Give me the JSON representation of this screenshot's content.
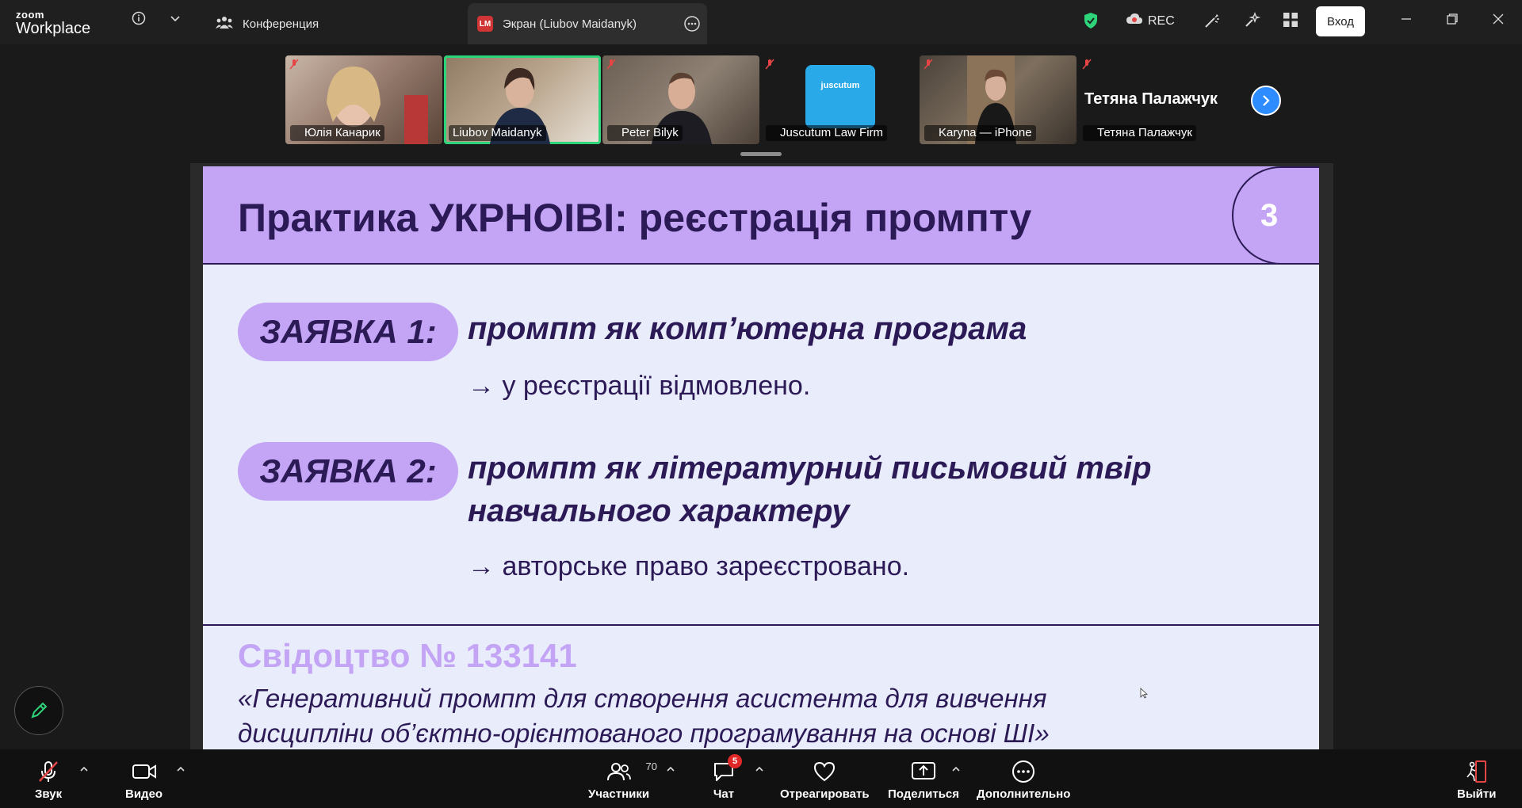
{
  "app": {
    "logo_top": "zoom",
    "logo_bottom": "Workplace",
    "colors": {
      "accent": "#2d8cff",
      "active_speaker": "#2ed47a",
      "rec": "#e64545",
      "slide_purple": "#c3a4f5",
      "slide_text": "#2b1a55"
    }
  },
  "titlebar": {
    "tab_conference": "Конференция",
    "tab_screen": "Экран (Liubov Maidanyk)",
    "tab_screen_avatar": "LM",
    "rec_label": "REC",
    "login_label": "Вход"
  },
  "gallery": {
    "participants": [
      {
        "name": "Юлія Канарик",
        "muted": true
      },
      {
        "name": "Liubov Maidanyk",
        "muted": false,
        "active": true
      },
      {
        "name": "Peter Bilyk",
        "muted": true
      },
      {
        "name": "Juscutum Law Firm",
        "muted": true
      },
      {
        "name": "Karyna — iPhone",
        "muted": true
      },
      {
        "name": "Тетяна Палажчук",
        "muted": true
      }
    ],
    "juscutum_logo_text": "juscutum",
    "big_name": "Тетяна Палажчук"
  },
  "slide": {
    "title": "Практика УКРНОІВІ: реєстрація промпту",
    "number": "3",
    "app1_label": "ЗАЯВКА 1:",
    "app1_heading": "промпт як комп’ютерна програма",
    "app1_result": "→ у реєстрації відмовлено.",
    "app2_label": "ЗАЯВКА 2:",
    "app2_heading_l1": "промпт як літературний письмовий твір",
    "app2_heading_l2": "навчального характеру",
    "app2_result": "→ авторське право зареєстровано.",
    "cert_title": "Свідоцтво № 133141",
    "cert_desc_l1": "«Генеративний промпт для створення асистента для вивчення",
    "cert_desc_l2": "дисципліни об’єктно-орієнтованого програмування на основі ШІ»"
  },
  "toolbar": {
    "audio": "Звук",
    "video": "Видео",
    "participants": "Участники",
    "participants_count": "70",
    "chat": "Чат",
    "chat_badge": "5",
    "react": "Отреагировать",
    "share": "Поделиться",
    "more": "Дополнительно",
    "leave": "Выйти"
  }
}
